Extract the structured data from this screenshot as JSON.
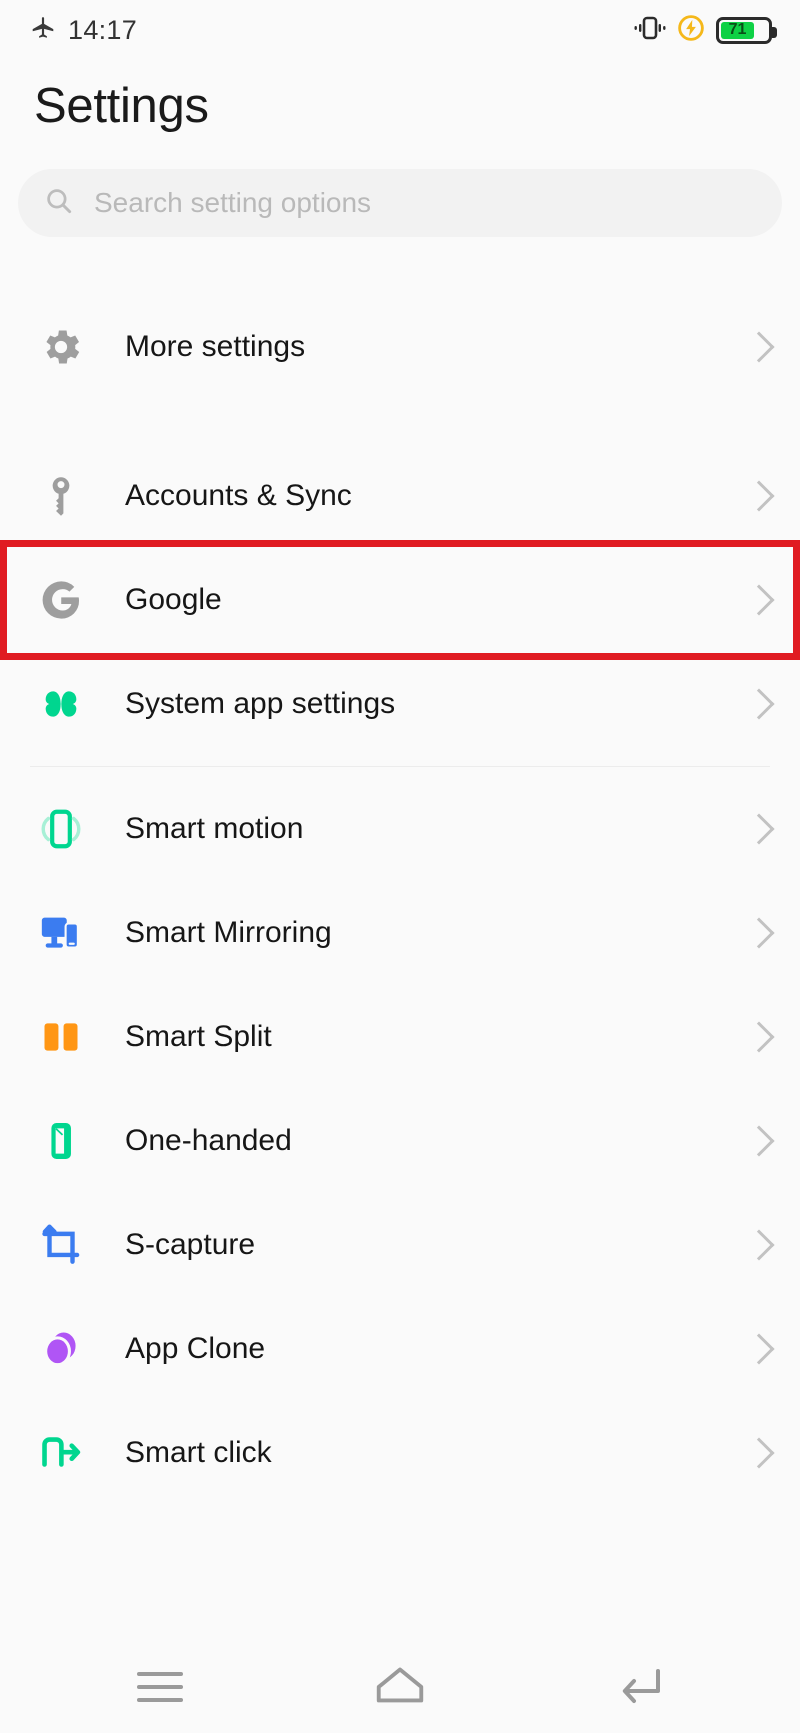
{
  "status_bar": {
    "airplane_icon": "airplane-mode-icon",
    "time": "14:17",
    "vibrate_icon": "vibrate-icon",
    "charging_icon": "charging-bolt-icon",
    "battery_percent": "71",
    "battery_color": "#0ed145"
  },
  "header": {
    "title": "Settings"
  },
  "search": {
    "icon": "search-icon",
    "placeholder": "Search setting options",
    "value": ""
  },
  "highlight": {
    "color": "#e01b22",
    "target": "Google"
  },
  "groups": [
    {
      "items": [
        {
          "label": "More settings",
          "icon": "gear-icon",
          "color": "#9e9e9e",
          "height": "tall"
        }
      ]
    },
    {
      "items": [
        {
          "label": "Accounts & Sync",
          "icon": "key-icon",
          "color": "#9e9e9e",
          "height": "normal"
        },
        {
          "label": "Google",
          "icon": "google-g-icon",
          "color": "#9e9e9e",
          "height": "normal",
          "highlighted": true
        },
        {
          "label": "System app settings",
          "icon": "clover-icon",
          "color": "#00d68f",
          "height": "normal"
        }
      ]
    },
    {
      "items": [
        {
          "label": "Smart motion",
          "icon": "phone-motion-icon",
          "color": "#00d68f",
          "height": "normal"
        },
        {
          "label": "Smart Mirroring",
          "icon": "screen-mirroring-icon",
          "color": "#3b7cf0",
          "height": "normal"
        },
        {
          "label": "Smart Split",
          "icon": "split-screen-icon",
          "color": "#ff9614",
          "height": "normal"
        },
        {
          "label": "One-handed",
          "icon": "one-handed-icon",
          "color": "#00d68f",
          "height": "normal"
        },
        {
          "label": "S-capture",
          "icon": "screen-capture-icon",
          "color": "#3b7cf0",
          "height": "normal"
        },
        {
          "label": "App Clone",
          "icon": "app-clone-icon",
          "color": "#b055f5",
          "height": "normal"
        },
        {
          "label": "Smart click",
          "icon": "smart-click-icon",
          "color": "#00d68f",
          "height": "normal"
        }
      ]
    }
  ],
  "navbar": {
    "recents_label": "recents-icon",
    "home_label": "home-icon",
    "back_label": "back-icon"
  }
}
